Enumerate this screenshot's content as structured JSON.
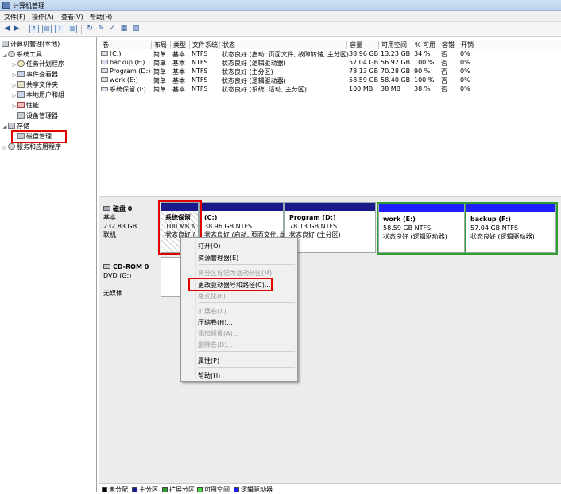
{
  "window": {
    "title": "计算机管理"
  },
  "menu": [
    "文件(F)",
    "操作(A)",
    "查看(V)",
    "帮助(H)"
  ],
  "tree": {
    "root": "计算机管理(本地)",
    "system_tools": "系统工具",
    "task_scheduler": "任务计划程序",
    "event_viewer": "事件查看器",
    "shared_folders": "共享文件夹",
    "local_users": "本地用户和组",
    "performance": "性能",
    "device_manager": "设备管理器",
    "storage": "存储",
    "disk_management": "磁盘管理",
    "services": "服务和应用程序"
  },
  "volumes": {
    "columns": [
      "卷",
      "布局",
      "类型",
      "文件系统",
      "状态",
      "容量",
      "可用空间",
      "% 可用",
      "容错",
      "开销"
    ],
    "rows": [
      {
        "name": "(C:)",
        "layout": "简单",
        "type": "基本",
        "fs": "NTFS",
        "status": "状态良好 (启动, 页面文件, 故障转储, 主分区)",
        "capacity": "38.96 GB",
        "free": "13.23 GB",
        "pct": "34 %",
        "ft": "否",
        "overhead": "0%"
      },
      {
        "name": "backup (F:)",
        "layout": "简单",
        "type": "基本",
        "fs": "NTFS",
        "status": "状态良好 (逻辑驱动器)",
        "capacity": "57.04 GB",
        "free": "56.92 GB",
        "pct": "100 %",
        "ft": "否",
        "overhead": "0%"
      },
      {
        "name": "Program (D:)",
        "layout": "简单",
        "type": "基本",
        "fs": "NTFS",
        "status": "状态良好 (主分区)",
        "capacity": "78.13 GB",
        "free": "70.28 GB",
        "pct": "90 %",
        "ft": "否",
        "overhead": "0%"
      },
      {
        "name": "work (E:)",
        "layout": "简单",
        "type": "基本",
        "fs": "NTFS",
        "status": "状态良好 (逻辑驱动器)",
        "capacity": "58.59 GB",
        "free": "58.40 GB",
        "pct": "100 %",
        "ft": "否",
        "overhead": "0%"
      },
      {
        "name": "系统保留 (I:)",
        "layout": "简单",
        "type": "基本",
        "fs": "NTFS",
        "status": "状态良好 (系统, 活动, 主分区)",
        "capacity": "100 MB",
        "free": "38 MB",
        "pct": "38 %",
        "ft": "否",
        "overhead": "0%"
      }
    ]
  },
  "disk0": {
    "name": "磁盘 0",
    "type": "基本",
    "size": "232.83 GB",
    "state": "联机",
    "partitions": [
      {
        "title": "系统保留",
        "line2": "100 MB N",
        "line3": "状态良好 ("
      },
      {
        "title": "(C:)",
        "line2": "38.96 GB NTFS",
        "line3": "状态良好 (启动, 页面文件, 故"
      },
      {
        "title": "Program  (D:)",
        "line2": "78.13 GB NTFS",
        "line3": "状态良好 (主分区)"
      },
      {
        "title": "work  (E:)",
        "line2": "58.59 GB NTFS",
        "line3": "状态良好 (逻辑驱动器)"
      },
      {
        "title": "backup  (F:)",
        "line2": "57.04 GB NTFS",
        "line3": "状态良好 (逻辑驱动器)"
      }
    ]
  },
  "cdrom": {
    "name": "CD-ROM 0",
    "drive": "DVD (G:)",
    "media": "无媒体"
  },
  "context_menu": {
    "open": "打开(O)",
    "explore": "资源管理器(E)",
    "mark_active": "将分区标记为活动分区(M)",
    "change_letter": "更改驱动器号和路径(C)...",
    "format": "格式化(F)...",
    "extend": "扩展卷(X)...",
    "shrink": "压缩卷(H)...",
    "add_mirror": "添加镜像(A)...",
    "delete": "删除卷(D)...",
    "properties": "属性(P)",
    "help": "帮助(H)"
  },
  "legend": [
    {
      "label": "未分配",
      "color": "#000000"
    },
    {
      "label": "主分区",
      "color": "#1a1a8c"
    },
    {
      "label": "扩展分区",
      "color": "#2e9e2e"
    },
    {
      "label": "可用空间",
      "color": "#44dd44"
    },
    {
      "label": "逻辑驱动器",
      "color": "#2020ff"
    }
  ]
}
